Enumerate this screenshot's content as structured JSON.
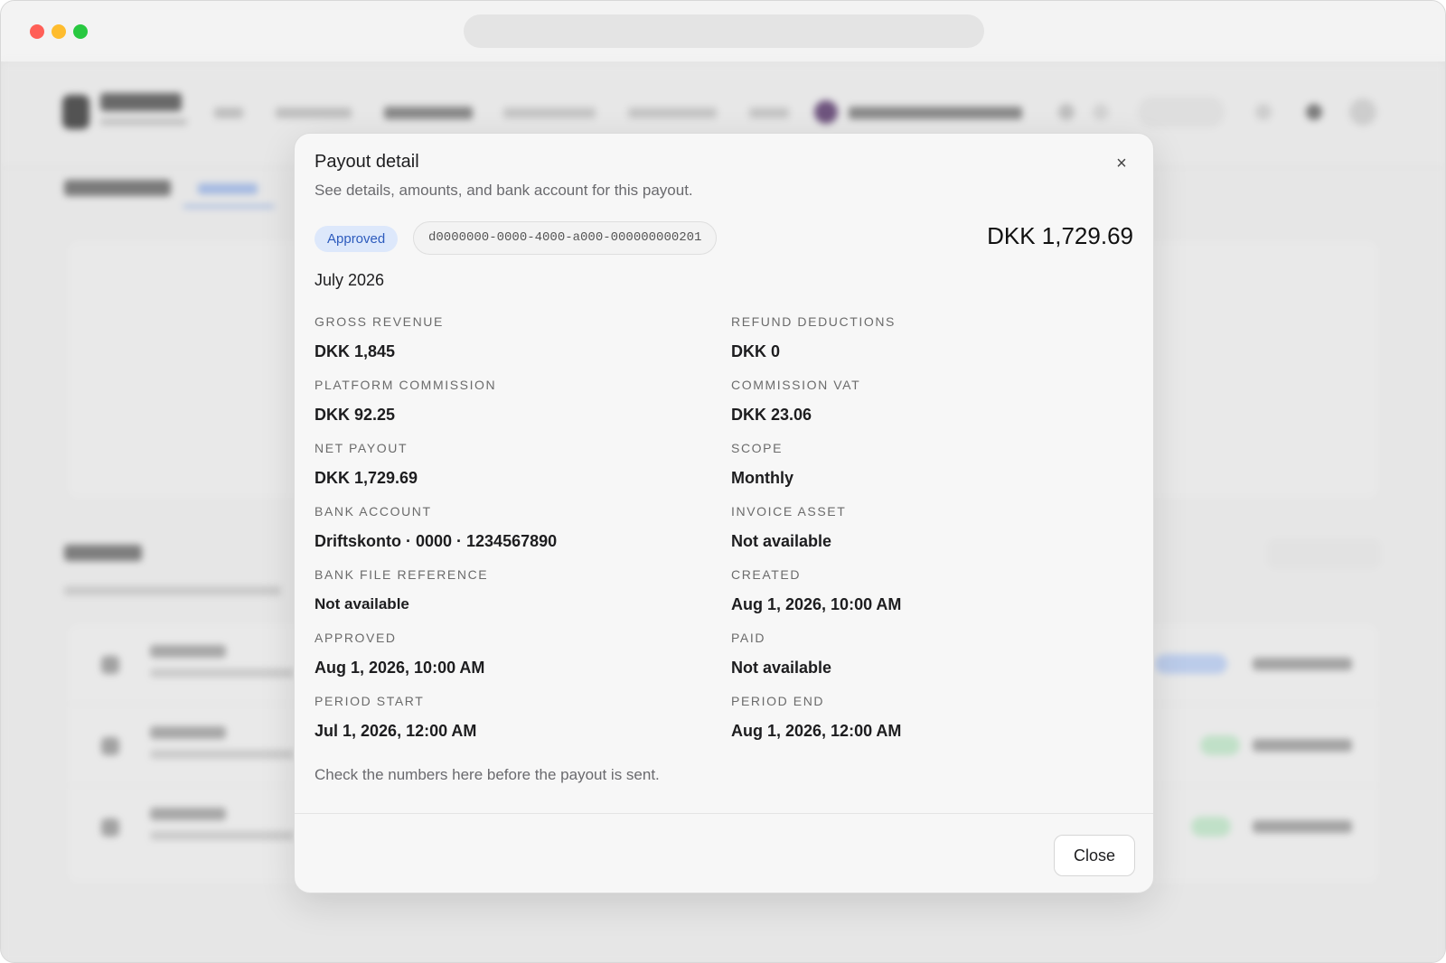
{
  "modal": {
    "title": "Payout detail",
    "description": "See details, amounts, and bank account for this payout.",
    "status": "Approved",
    "payout_id": "d0000000-0000-4000-a000-000000000201",
    "total_amount": "DKK 1,729.69",
    "period": "July 2026",
    "fields": {
      "gross_revenue": {
        "label": "GROSS REVENUE",
        "value": "DKK 1,845"
      },
      "refund_deductions": {
        "label": "REFUND DEDUCTIONS",
        "value": "DKK 0"
      },
      "platform_commission": {
        "label": "PLATFORM COMMISSION",
        "value": "DKK 92.25"
      },
      "commission_vat": {
        "label": "COMMISSION VAT",
        "value": "DKK 23.06"
      },
      "net_payout": {
        "label": "NET PAYOUT",
        "value": "DKK 1,729.69"
      },
      "scope": {
        "label": "SCOPE",
        "value": "Monthly"
      },
      "bank_account": {
        "label": "BANK ACCOUNT",
        "value": "Driftskonto · 0000 · 1234567890"
      },
      "invoice_asset": {
        "label": "INVOICE ASSET",
        "value": "Not available"
      },
      "bank_file_reference": {
        "label": "BANK FILE REFERENCE",
        "value": "Not available"
      },
      "created": {
        "label": "CREATED",
        "value": "Aug 1, 2026, 10:00 AM"
      },
      "approved": {
        "label": "APPROVED",
        "value": "Aug 1, 2026, 10:00 AM"
      },
      "paid": {
        "label": "PAID",
        "value": "Not available"
      },
      "period_start": {
        "label": "PERIOD START",
        "value": "Jul 1, 2026, 12:00 AM"
      },
      "period_end": {
        "label": "PERIOD END",
        "value": "Aug 1, 2026, 12:00 AM"
      }
    },
    "note": "Check the numbers here before the payout is sent.",
    "close_label": "Close",
    "close_icon": "×"
  },
  "colors": {
    "status_badge_bg": "#dde8fb",
    "status_badge_text": "#2d5bbd"
  }
}
